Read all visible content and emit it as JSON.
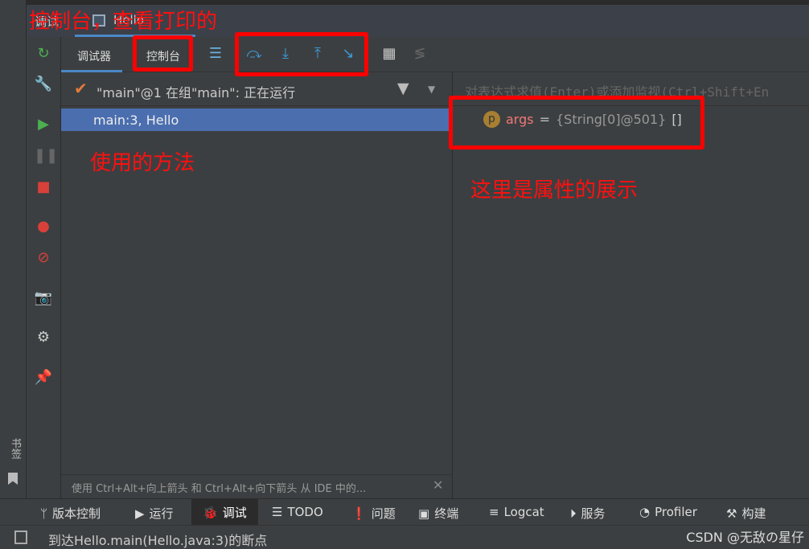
{
  "window": {
    "tab_debug": "调试",
    "tab_file": "Hello"
  },
  "tabs": {
    "debugger": "调试器",
    "console": "控制台"
  },
  "thread": {
    "label": "\"main\"@1 在组\"main\": 正在运行"
  },
  "frames": [
    {
      "label": "main:3, Hello",
      "selected": true
    }
  ],
  "hint": "使用 Ctrl+Alt+向上箭头 和 Ctrl+Alt+向下箭头 从 IDE 中的...",
  "eval_placeholder": "对表达式求值(Enter)或添加监视(Ctrl+Shift+En",
  "variables": [
    {
      "badge": "p",
      "name": "args",
      "eq": "=",
      "value": "{String[0]@501}",
      "extra": "[]"
    }
  ],
  "tool_windows": [
    {
      "icon": "branch-icon",
      "label": "版本控制"
    },
    {
      "icon": "play-icon",
      "label": "运行"
    },
    {
      "icon": "bug-icon",
      "label": "调试",
      "active": true
    },
    {
      "icon": "list-icon",
      "label": "TODO"
    },
    {
      "icon": "alert-icon",
      "label": "问题"
    },
    {
      "icon": "terminal-icon",
      "label": "终端"
    },
    {
      "icon": "logcat-icon",
      "label": "Logcat"
    },
    {
      "icon": "services-icon",
      "label": "服务"
    },
    {
      "icon": "profiler-icon",
      "label": "Profiler"
    },
    {
      "icon": "hammer-icon",
      "label": "构建"
    }
  ],
  "status": {
    "message": "到达Hello.main(Hello.java:3)的断点",
    "watermark": "CSDN @无敌の星仔"
  },
  "sidebar_vertical": "书签",
  "annotations": {
    "top": "控制台，查看打印的",
    "method": "使用的方法",
    "props": "这里是属性的展示"
  },
  "colors": {
    "annotation": "#ff0000",
    "selection": "#4b6eaf",
    "var_name": "#f07878"
  }
}
